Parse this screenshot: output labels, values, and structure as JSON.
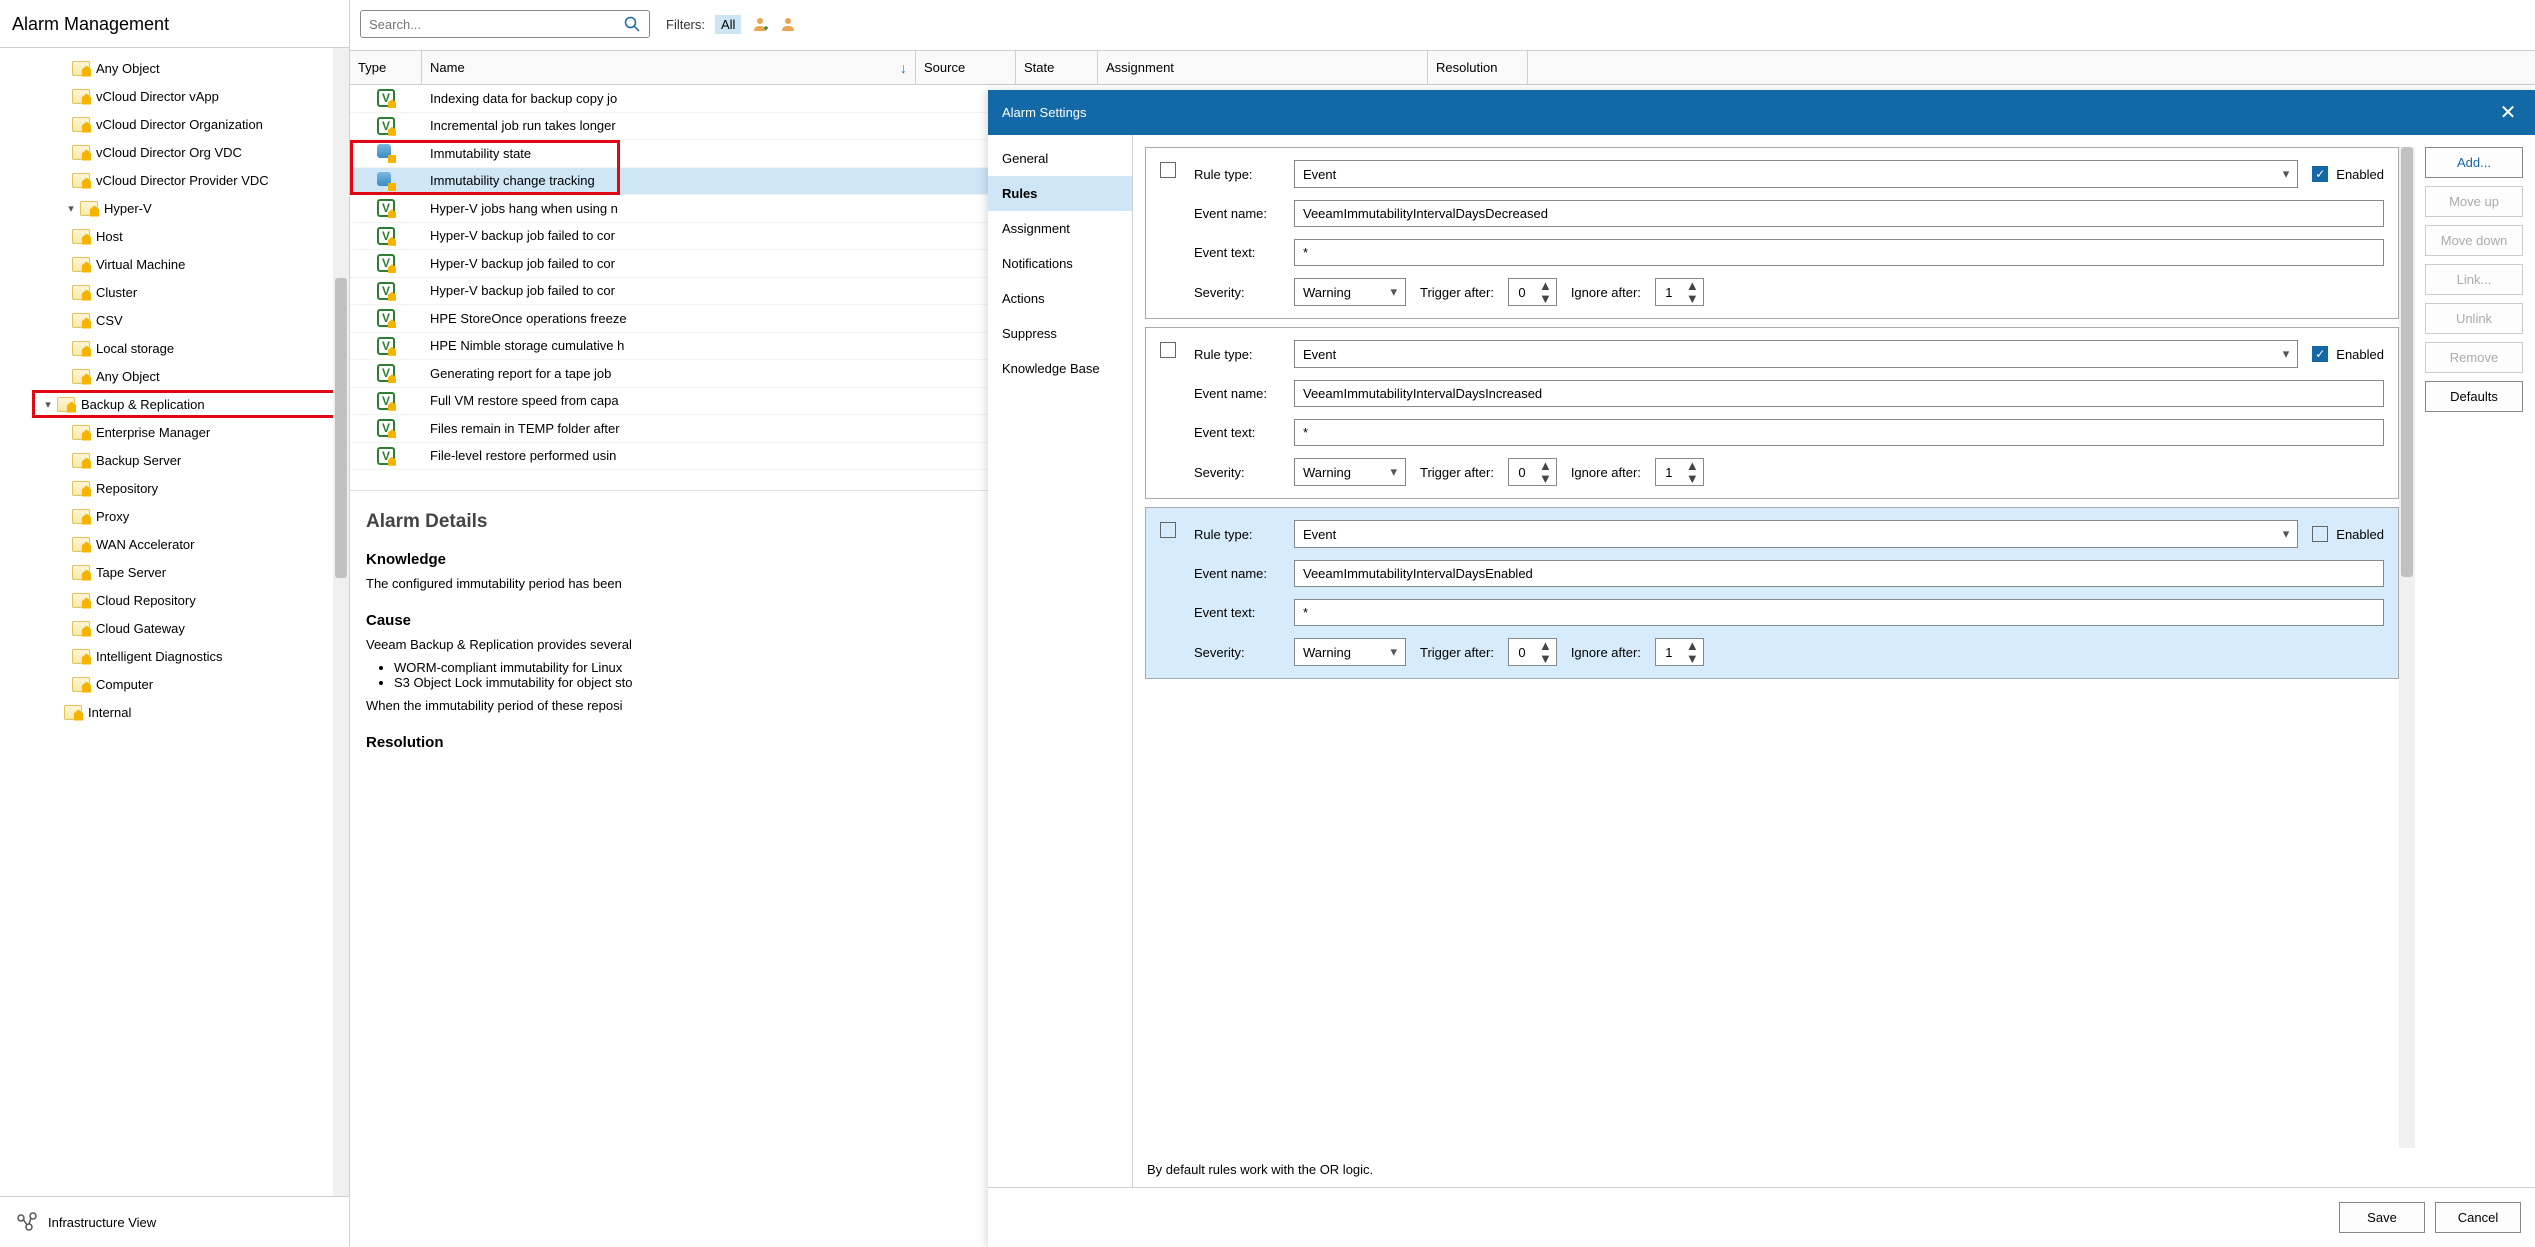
{
  "left_header": "Alarm Management",
  "tree": {
    "any_object_top": "Any Object",
    "vcd_vapp": "vCloud Director vApp",
    "vcd_org": "vCloud Director Organization",
    "vcd_orgvdc": "vCloud Director Org VDC",
    "vcd_provvdc": "vCloud Director Provider VDC",
    "hyperv": "Hyper-V",
    "host": "Host",
    "vm": "Virtual Machine",
    "cluster": "Cluster",
    "csv": "CSV",
    "local_storage": "Local storage",
    "any_object": "Any Object",
    "bnr": "Backup & Replication",
    "em": "Enterprise Manager",
    "backup_server": "Backup Server",
    "repository": "Repository",
    "proxy": "Proxy",
    "wan": "WAN Accelerator",
    "tape": "Tape Server",
    "cloud_repo": "Cloud Repository",
    "cloud_gw": "Cloud Gateway",
    "idiag": "Intelligent Diagnostics",
    "computer": "Computer",
    "internal": "Internal"
  },
  "infra_view": "Infrastructure View",
  "search_placeholder": "Search...",
  "filters_label": "Filters:",
  "filters_all": "All",
  "grid_headers": {
    "type": "Type",
    "name": "Name",
    "source": "Source",
    "state": "State",
    "assignment": "Assignment",
    "resolution": "Resolution"
  },
  "rows": [
    "Indexing data for backup copy jo",
    "Incremental job run takes longer",
    "Immutability state",
    "Immutability change tracking",
    "Hyper-V jobs hang when using n",
    "Hyper-V backup job failed to cor",
    "Hyper-V backup job failed to cor",
    "Hyper-V backup job failed to cor",
    "HPE StoreOnce operations freeze",
    "HPE Nimble storage cumulative h",
    "Generating report for a tape job",
    "Full VM restore speed from capa",
    "Files remain in TEMP folder after",
    "File-level restore performed usin"
  ],
  "details": {
    "title": "Alarm Details",
    "knowledge_h": "Knowledge",
    "knowledge_p": "The configured immutability period has been",
    "cause_h": "Cause",
    "cause_p": "Veeam Backup & Replication provides several",
    "bullet1": "WORM-compliant immutability for Linux",
    "bullet2": "S3 Object Lock immutability for object sto",
    "cause_p2": "When the immutability period of these reposi",
    "resolution_h": "Resolution"
  },
  "dialog": {
    "title": "Alarm Settings",
    "nav": {
      "general": "General",
      "rules": "Rules",
      "assignment": "Assignment",
      "notifications": "Notifications",
      "actions": "Actions",
      "suppress": "Suppress",
      "kb": "Knowledge Base"
    },
    "labels": {
      "rule_type": "Rule type:",
      "event_name": "Event name:",
      "event_text": "Event text:",
      "severity": "Severity:",
      "trigger_after": "Trigger after:",
      "ignore_after": "Ignore after:",
      "enabled": "Enabled"
    },
    "values": {
      "event": "Event",
      "warning": "Warning",
      "star": "*",
      "zero": "0",
      "one": "1",
      "evname1": "VeeamImmutabilityIntervalDaysDecreased",
      "evname2": "VeeamImmutabilityIntervalDaysIncreased",
      "evname3": "VeeamImmutabilityIntervalDaysEnabled"
    },
    "buttons": {
      "add": "Add...",
      "moveup": "Move up",
      "movedown": "Move down",
      "link": "Link...",
      "unlink": "Unlink",
      "remove": "Remove",
      "defaults": "Defaults"
    },
    "hint": "By default rules work with the OR logic.",
    "save": "Save",
    "cancel": "Cancel"
  }
}
